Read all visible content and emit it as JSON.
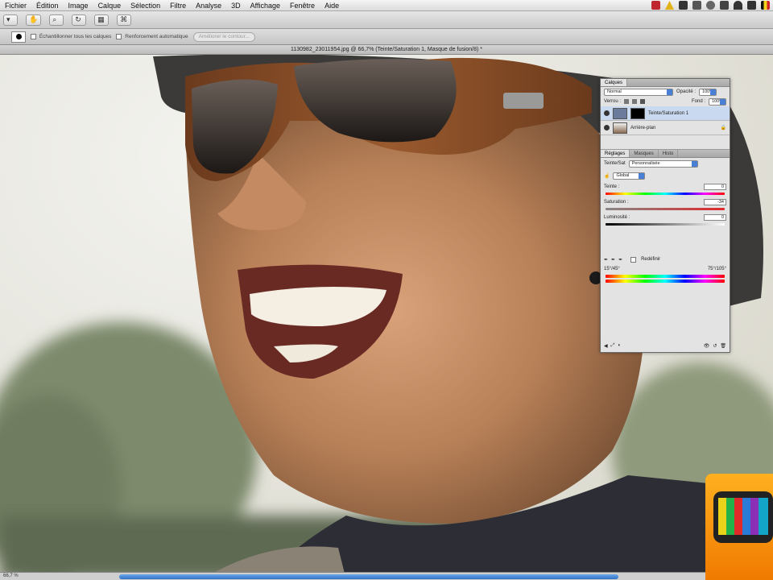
{
  "menubar": {
    "items": [
      "Fichier",
      "Édition",
      "Image",
      "Calque",
      "Sélection",
      "Filtre",
      "Analyse",
      "3D",
      "Affichage",
      "Fenêtre",
      "Aide"
    ]
  },
  "optionsbar": {
    "sample_all_layers": "Échantillonner tous les calques",
    "auto_enhance": "Renforcement automatique",
    "refine_edge": "Améliorer le contour..."
  },
  "document": {
    "title": "1130982_23011954.jpg @ 66,7% (Teinte/Saturation 1, Masque de fusion/8) *"
  },
  "layers_panel": {
    "tab": "Calques",
    "blend_mode": "Normal",
    "opacity_label": "Opacité :",
    "opacity_value": "100%",
    "lock_label": "Verrou :",
    "fill_label": "Fond :",
    "fill_value": "100%",
    "layers": [
      {
        "name": "Teinte/Saturation 1"
      },
      {
        "name": "Arrière-plan"
      }
    ]
  },
  "adjustments_panel": {
    "tabs": [
      "Réglages",
      "Masques",
      "Histo"
    ],
    "title_label": "Teinte/Sat",
    "preset": "Personnalisée",
    "channel": "Global",
    "hue_label": "Teinte :",
    "hue_value": "0",
    "saturation_label": "Saturation :",
    "saturation_value": "-34",
    "lightness_label": "Luminosité :",
    "lightness_value": "0",
    "colorize_label": "Redéfinir",
    "range_left": "15°/45°",
    "range_right": "75°/105°"
  },
  "statusbar": {
    "zoom": "66,7 %"
  }
}
